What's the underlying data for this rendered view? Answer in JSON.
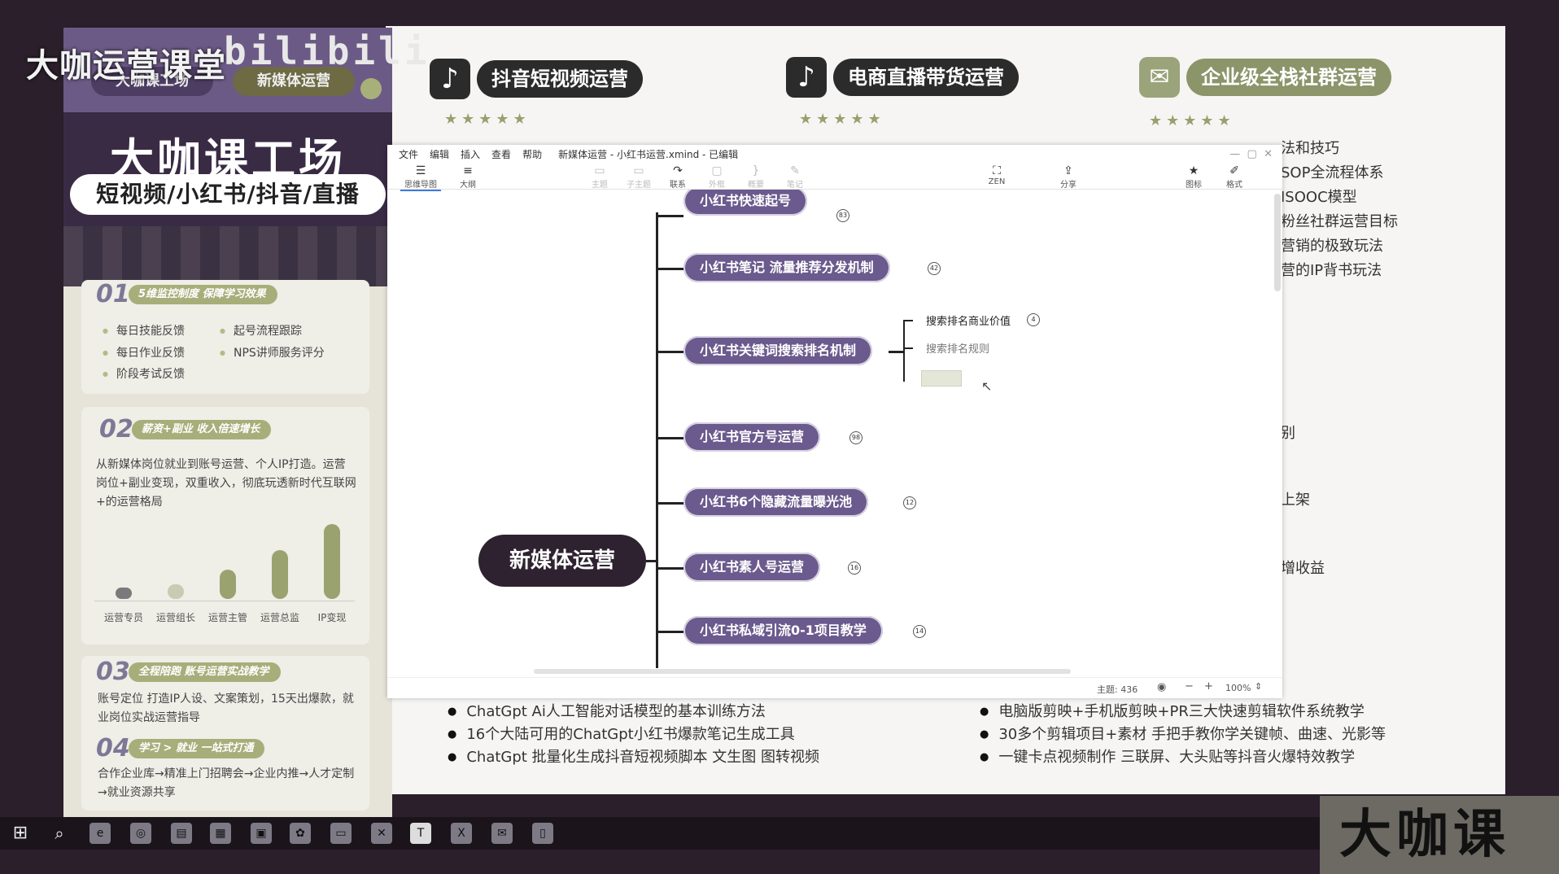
{
  "watermark": {
    "title": "大咖运营课堂",
    "brand": "bilibili",
    "bottom_right": "大咖课"
  },
  "promo": {
    "tag1": "大咖课工场",
    "tag2": "新媒体运营",
    "title": "大咖课工场",
    "subtitle": "短视频/小红书/抖音/直播"
  },
  "left_sections": [
    {
      "num": "01",
      "title": "5维监控制度 保障学习效果",
      "bullets": [
        "每日技能反馈",
        "起号流程跟踪",
        "每日作业反馈",
        "NPS讲师服务评分",
        "阶段考试反馈"
      ]
    },
    {
      "num": "02",
      "title": "薪资+副业 收入倍速增长",
      "text": "从新媒体岗位就业到账号运营、个人IP打造。运营岗位+副业变现，双重收入，彻底玩透新时代互联网+的运营格局",
      "bars": [
        "运营专员",
        "运营组长",
        "运营主管",
        "运营总监",
        "IP变现"
      ]
    },
    {
      "num": "03",
      "title": "全程陪跑 账号运营实战教学",
      "text": "账号定位 打造IP人设、文案策划，15天出爆款，就业岗位实战运营指导"
    },
    {
      "num": "04",
      "title": "学习 > 就业 一站式打通",
      "text": "合作企业库→精准上门招聘会→企业内推→人才定制→就业资源共享"
    }
  ],
  "courses": [
    {
      "icon": "tiktok-icon",
      "glyph": "♪",
      "label": "抖音短视频运营",
      "stars": "★★★★★"
    },
    {
      "icon": "tiktok-icon",
      "glyph": "♪",
      "label": "电商直播带货运营",
      "stars": "★★★★★"
    },
    {
      "icon": "wechat-icon",
      "glyph": "✉",
      "label": "企业级全栈社群运营",
      "stars": "★★★★★"
    }
  ],
  "right_column_lines": [
    "法和技巧",
    "SOP全流程体系",
    "ISOOC模型",
    "粉丝社群运营目标",
    "营销的极致玩法",
    "营的IP背书玩法",
    "别",
    "上架",
    "增收益"
  ],
  "bottom_features_left": [
    "ChatGpt Ai人工智能对话模型的基本训练方法",
    "16个大陆可用的ChatGpt小红书爆款笔记生成工具",
    "ChatGpt 批量化生成抖音短视频脚本 文生图 图转视频"
  ],
  "bottom_features_right": [
    "电脑版剪映+手机版剪映+PR三大快速剪辑软件系统教学",
    "30多个剪辑项目+素材 手把手教你学关键帧、曲速、光影等",
    "一键卡点视频制作 三联屏、大头贴等抖音火爆特效教学"
  ],
  "xmind": {
    "menu": [
      "文件",
      "编辑",
      "插入",
      "查看",
      "帮助"
    ],
    "filename": "新媒体运营 - 小红书运营.xmind - 已编辑",
    "toolbar": [
      {
        "label": "思维导图",
        "icon": "☰"
      },
      {
        "label": "大纲",
        "icon": "≡"
      },
      {
        "label": "主题",
        "icon": "▭"
      },
      {
        "label": "子主题",
        "icon": "▭"
      },
      {
        "label": "联系",
        "icon": "↷"
      },
      {
        "label": "外框",
        "icon": "▢"
      },
      {
        "label": "概要",
        "icon": "}"
      },
      {
        "label": "笔记",
        "icon": "✎"
      },
      {
        "label": "ZEN",
        "icon": "⛶"
      },
      {
        "label": "分享",
        "icon": "⇪"
      },
      {
        "label": "图标",
        "icon": "★"
      },
      {
        "label": "格式",
        "icon": "✐"
      }
    ],
    "root": "新媒体运营",
    "branches": [
      {
        "label": "小红书快速起号",
        "count": "83"
      },
      {
        "label": "小红书笔记 流量推荐分发机制",
        "count": "42"
      },
      {
        "label": "小红书关键词搜索排名机制",
        "count": ""
      },
      {
        "label": "小红书官方号运营",
        "count": "98"
      },
      {
        "label": "小红书6个隐藏流量曝光池",
        "count": "12"
      },
      {
        "label": "小红书素人号运营",
        "count": "16"
      },
      {
        "label": "小红书私域引流0-1项目教学",
        "count": "14"
      }
    ],
    "subtopics": [
      {
        "label": "搜索排名商业价值",
        "count": "4"
      },
      {
        "label": "搜索排名规则",
        "count": ""
      }
    ],
    "status": {
      "topics": "主题: 436",
      "zoom": "100%"
    }
  },
  "taskbar": [
    "⊞",
    "⌕",
    "e",
    "◎",
    "▤",
    "▦",
    "▣",
    "✿",
    "▭",
    "✕",
    "T",
    "X",
    "✉",
    "▯"
  ]
}
